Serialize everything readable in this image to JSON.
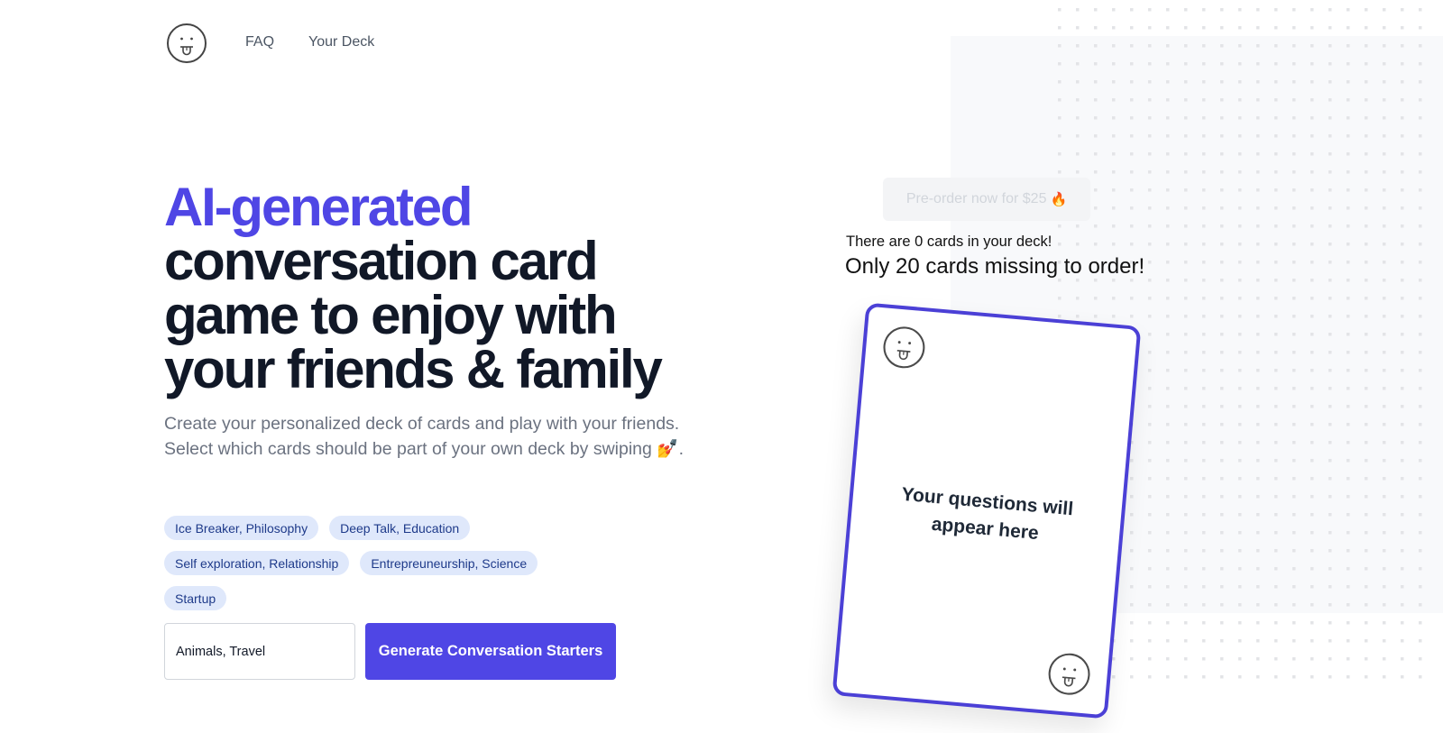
{
  "header": {
    "logo_icon": "tongue-out-face-icon",
    "nav": [
      {
        "label": "FAQ"
      },
      {
        "label": "Your Deck"
      }
    ]
  },
  "hero": {
    "title_accent": "AI-generated",
    "title_rest_lines": [
      "conversation card",
      "game to enjoy with",
      "your friends & family"
    ],
    "subtitle_lines": [
      "Create your personalized deck of cards and play with your friends.",
      "Select which cards should be part of your own deck by swiping 💅."
    ]
  },
  "topics": {
    "tags": [
      {
        "label": "Ice Breaker, Philosophy"
      },
      {
        "label": "Deep Talk, Education"
      },
      {
        "label": "Self exploration, Relationship"
      },
      {
        "label": "Entrepreuneurship, Science"
      },
      {
        "label": "Startup"
      }
    ],
    "input_value": "Animals, Travel",
    "generate_label": "Generate Conversation Starters"
  },
  "deck": {
    "preorder_label": "Pre-order now for $25",
    "preorder_emoji": "🔥",
    "count_text": "There are 0 cards in your deck!",
    "missing_text": "Only 20 cards missing to order!",
    "cards_in_deck": 0,
    "cards_missing": 20,
    "price": "$25"
  },
  "card": {
    "placeholder_text": "Your questions will appear here",
    "corner_icon": "tongue-out-face-icon"
  },
  "colors": {
    "accent": "#4f46e5",
    "heading": "#111827",
    "muted": "#6b7280",
    "tag_bg": "#dfe8fb",
    "tag_text": "#1e3a8a",
    "card_border": "#4b40d6"
  }
}
